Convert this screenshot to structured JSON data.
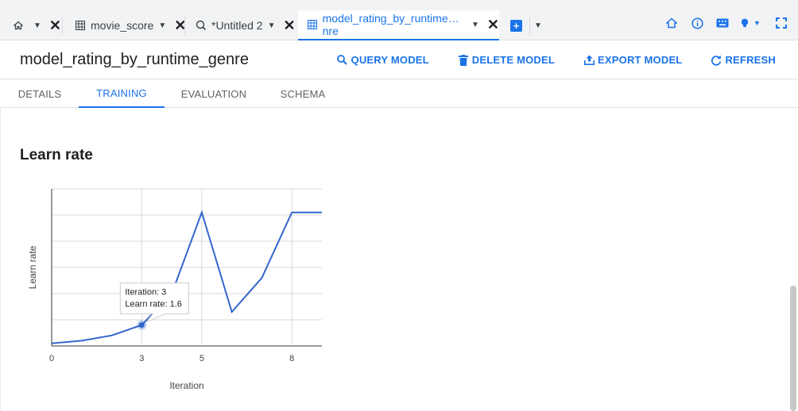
{
  "tabs": [
    {
      "label": "",
      "icon": "home-icon",
      "active": false
    },
    {
      "label": "movie_score",
      "icon": "table-icon",
      "active": false
    },
    {
      "label": "*Untitled 2",
      "icon": "query-icon",
      "active": false
    },
    {
      "label": "model_rating_by_runtime… nre",
      "icon": "model-icon",
      "active": true
    }
  ],
  "header": {
    "title": "model_rating_by_runtime_genre",
    "actions": [
      "QUERY MODEL",
      "DELETE MODEL",
      "EXPORT MODEL",
      "REFRESH"
    ]
  },
  "subtabs": [
    "DETAILS",
    "TRAINING",
    "EVALUATION",
    "SCHEMA"
  ],
  "active_subtab": "TRAINING",
  "section": {
    "title": "Learn rate"
  },
  "tooltip": {
    "line1": "Iteration: 3",
    "line2": "Learn rate: 1.6"
  },
  "colors": {
    "accent": "#1a73e8",
    "line": "#3366cc"
  },
  "chart_data": {
    "type": "line",
    "xlabel": "Iteration",
    "ylabel": "Learn rate",
    "x_ticks": [
      "0",
      "3",
      "5",
      "8"
    ],
    "x_tick_values": [
      0,
      3,
      5,
      8
    ],
    "xlim": [
      0,
      9
    ],
    "ylim": [
      0,
      6
    ],
    "grid": true,
    "series": [
      {
        "x": [
          0,
          1,
          2,
          3,
          4,
          5,
          6,
          7,
          8,
          9
        ],
        "y": [
          0.1,
          0.2,
          0.4,
          0.8,
          2.0,
          5.1,
          1.3,
          2.6,
          5.1,
          5.1
        ]
      }
    ],
    "highlight_index": 3
  }
}
